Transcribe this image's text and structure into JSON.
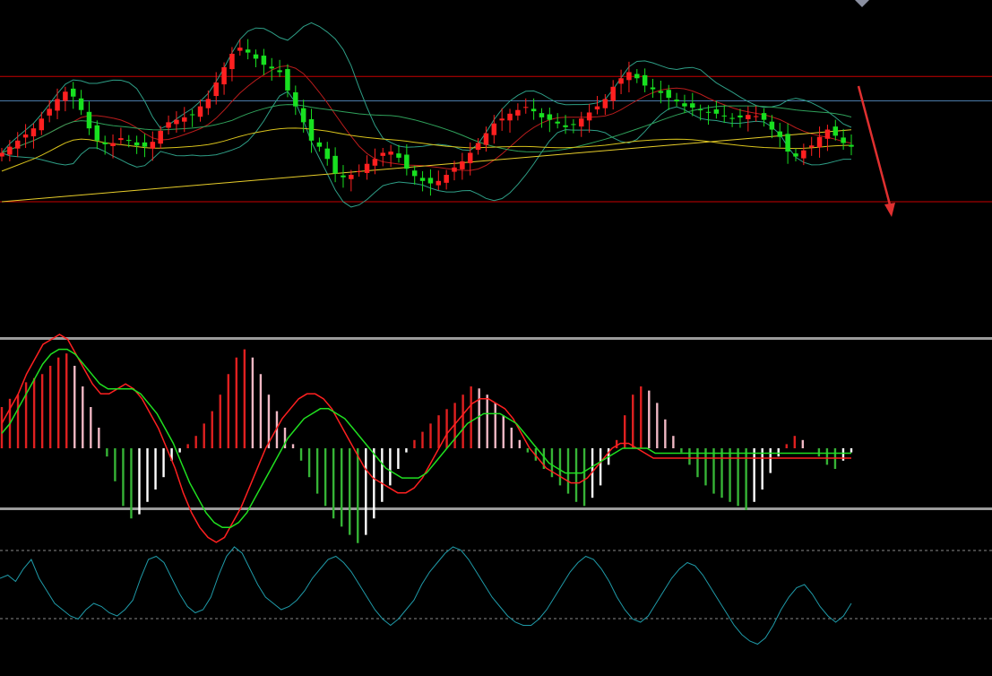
{
  "colors": {
    "background": "#000000",
    "candle_up": "#ff2020",
    "candle_down": "#18e020",
    "bollinger": "#2e9e86",
    "ma_short": "#b81c1c",
    "ma_mid": "#2fa05a",
    "ma_long": "#d8c21c",
    "ma_xlong": "#e6cc2a",
    "resistance_line": "#c80000",
    "support_line": "#c80000",
    "reference_line": "#4a7aa8",
    "forecast_arrow": "#e03030",
    "panel_separator": "#9a9a9a",
    "macd_fast": "#ff2020",
    "macd_signal": "#20e020",
    "hist_pos_up": "#e02020",
    "hist_pos_down": "#f0b8c4",
    "hist_neg_down": "#36b436",
    "hist_neg_up": "#ffffff",
    "oscillator": "#1f9aa8",
    "oscillator_levels": "#8a8a8a"
  },
  "chart_data": [
    {
      "type": "candlestick",
      "panel": "price",
      "bars": 80,
      "close": [
        30.0,
        31.0,
        32.0,
        33.0,
        34.0,
        35.6,
        37.2,
        38.8,
        40.0,
        39.2,
        37.0,
        34.0,
        32.0,
        31.4,
        31.6,
        32.4,
        32.0,
        31.2,
        31.0,
        31.8,
        33.6,
        35.0,
        35.4,
        35.8,
        36.2,
        37.6,
        38.8,
        41.5,
        44.0,
        46.2,
        47.2,
        46.4,
        45.4,
        44.4,
        43.8,
        43.2,
        40.2,
        37.6,
        35.0,
        32.0,
        31.0,
        29.0,
        26.6,
        26.0,
        26.4,
        27.0,
        28.2,
        29.0,
        30.0,
        30.2,
        29.2,
        27.4,
        26.2,
        25.4,
        25.0,
        25.4,
        26.4,
        27.6,
        28.6,
        30.0,
        31.6,
        33.2,
        34.8,
        35.6,
        36.4,
        37.0,
        37.5,
        36.8,
        35.8,
        35.4,
        34.8,
        34.2,
        34.6,
        35.6,
        36.6,
        37.6,
        38.8,
        40.8,
        42.2,
        43.2,
        42.2,
        41.0,
        40.4,
        39.8,
        39.0,
        38.4,
        37.6,
        37.4,
        37.0,
        36.6,
        36.4,
        36.0,
        35.6,
        35.8,
        36.2,
        36.0,
        35.4,
        33.8,
        32.6,
        30.2,
        29.4,
        30.4,
        31.2,
        32.6,
        33.8,
        32.8,
        31.6,
        31.0
      ],
      "open_close_note": "",
      "overlays": {
        "bollinger": true,
        "moving_averages": 4,
        "horizontal_lines": [
          "resistance",
          "reference",
          "support"
        ],
        "forecast_arrow": "down"
      },
      "grid": false,
      "legend": "none"
    },
    {
      "type": "macd",
      "panel": "middle",
      "histogram": [
        2,
        2.4,
        2.6,
        3.2,
        3.4,
        3.6,
        4,
        4.4,
        4.6,
        4,
        3,
        2,
        1,
        -0.4,
        -1.6,
        -2.8,
        -3.4,
        -3.2,
        -2.6,
        -2,
        -1.4,
        -0.6,
        -0.2,
        0.2,
        0.6,
        1.2,
        1.8,
        2.6,
        3.6,
        4.4,
        4.8,
        4.4,
        3.6,
        2.6,
        1.8,
        1,
        0.2,
        -0.6,
        -1.4,
        -2.2,
        -2.8,
        -3.4,
        -3.8,
        -4.2,
        -4.6,
        -4.2,
        -3.4,
        -2.6,
        -1.8,
        -1.0,
        -0.2,
        0.4,
        0.8,
        1.2,
        1.6,
        1.9,
        2.2,
        2.6,
        3.0,
        2.9,
        2.6,
        2.2,
        1.6,
        1.0,
        0.4,
        -0.2,
        -0.6,
        -1.0,
        -1.4,
        -1.8,
        -2.2,
        -2.6,
        -2.8,
        -2.4,
        -1.8,
        -0.8,
        0.4,
        1.6,
        2.6,
        3.0,
        2.8,
        2.2,
        1.4,
        0.6,
        -0.2,
        -0.8,
        -1.4,
        -1.8,
        -2.2,
        -2.4,
        -2.6,
        -2.8,
        -3.0,
        -2.6,
        -2.0,
        -1.2,
        -0.4,
        0.2,
        0.6,
        0.4,
        0.0,
        -0.4,
        -0.8,
        -1.0,
        -0.6,
        -0.2
      ],
      "fast": [
        1,
        1.6,
        2.2,
        3,
        3.6,
        4.2,
        4.4,
        4.6,
        4.4,
        3.8,
        3.2,
        2.6,
        2.2,
        2.2,
        2.4,
        2.6,
        2.4,
        2.0,
        1.4,
        0.8,
        0.0,
        -0.8,
        -1.8,
        -2.6,
        -3.2,
        -3.6,
        -3.8,
        -3.6,
        -3.0,
        -2.4,
        -1.6,
        -0.8,
        0.0,
        0.6,
        1.2,
        1.6,
        2.0,
        2.2,
        2.2,
        2.0,
        1.6,
        1.0,
        0.4,
        -0.2,
        -0.8,
        -1.2,
        -1.4,
        -1.6,
        -1.8,
        -1.8,
        -1.6,
        -1.2,
        -0.6,
        0.0,
        0.6,
        1.0,
        1.4,
        1.8,
        2.0,
        2.0,
        1.8,
        1.6,
        1.2,
        0.6,
        0.0,
        -0.4,
        -0.8,
        -1.0,
        -1.2,
        -1.4,
        -1.4,
        -1.2,
        -0.8,
        -0.4,
        0.0,
        0.2,
        0.2,
        0.0,
        -0.2,
        -0.4,
        -0.4,
        -0.4,
        -0.4,
        -0.4,
        -0.4,
        -0.4,
        -0.4,
        -0.4,
        -0.4,
        -0.4,
        -0.4,
        -0.4,
        -0.4,
        -0.4,
        -0.4,
        -0.4,
        -0.4,
        -0.4,
        -0.4,
        -0.4,
        -0.4,
        -0.4,
        -0.4,
        -0.4
      ],
      "signal": [
        0.6,
        1.0,
        1.6,
        2.2,
        2.8,
        3.4,
        3.8,
        4.0,
        4.0,
        3.8,
        3.4,
        3.0,
        2.6,
        2.4,
        2.4,
        2.4,
        2.4,
        2.2,
        1.8,
        1.4,
        0.8,
        0.2,
        -0.6,
        -1.4,
        -2.0,
        -2.6,
        -3.0,
        -3.2,
        -3.2,
        -3.0,
        -2.6,
        -2.0,
        -1.4,
        -0.8,
        -0.2,
        0.4,
        0.8,
        1.2,
        1.4,
        1.6,
        1.6,
        1.4,
        1.2,
        0.8,
        0.4,
        0.0,
        -0.4,
        -0.8,
        -1.0,
        -1.2,
        -1.2,
        -1.2,
        -1.0,
        -0.6,
        -0.2,
        0.2,
        0.6,
        1.0,
        1.2,
        1.4,
        1.4,
        1.4,
        1.2,
        1.0,
        0.6,
        0.2,
        -0.2,
        -0.6,
        -0.8,
        -1.0,
        -1.0,
        -1.0,
        -0.8,
        -0.6,
        -0.4,
        -0.2,
        0.0,
        0.0,
        0.0,
        0.0,
        -0.2,
        -0.2,
        -0.2,
        -0.2,
        -0.2,
        -0.2,
        -0.2,
        -0.2,
        -0.2,
        -0.2,
        -0.2,
        -0.2,
        -0.2,
        -0.2,
        -0.2,
        -0.2,
        -0.2,
        -0.2,
        -0.2,
        -0.2,
        -0.2,
        -0.2,
        -0.2,
        -0.2,
        -0.2
      ],
      "zero_line": true,
      "grid": false,
      "legend": "none"
    },
    {
      "type": "line",
      "panel": "bottom",
      "name": "",
      "values": [
        60,
        62,
        58,
        66,
        72,
        60,
        52,
        44,
        40,
        36,
        34,
        40,
        44,
        42,
        38,
        36,
        40,
        46,
        60,
        72,
        74,
        70,
        60,
        50,
        42,
        38,
        40,
        48,
        62,
        74,
        80,
        76,
        66,
        56,
        48,
        44,
        40,
        42,
        46,
        52,
        60,
        66,
        72,
        74,
        70,
        64,
        56,
        48,
        40,
        34,
        30,
        34,
        40,
        46,
        56,
        64,
        70,
        76,
        80,
        78,
        72,
        64,
        56,
        48,
        42,
        36,
        32,
        30,
        30,
        34,
        40,
        48,
        56,
        64,
        70,
        74,
        72,
        66,
        58,
        48,
        40,
        34,
        32,
        36,
        44,
        52,
        60,
        66,
        70,
        68,
        62,
        54,
        46,
        38,
        30,
        24,
        20,
        18,
        22,
        30,
        40,
        48,
        54,
        56,
        50,
        42,
        36,
        32,
        36,
        44
      ],
      "levels": [
        80,
        20
      ],
      "ylim": [
        0,
        100
      ],
      "grid": false,
      "legend": "none"
    }
  ]
}
